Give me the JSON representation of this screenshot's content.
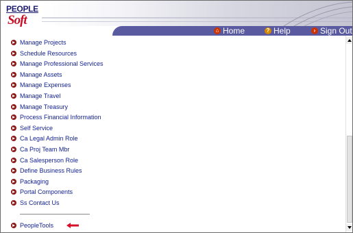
{
  "logo": {
    "line1": "PEOPLE",
    "line2": "Soft"
  },
  "nav": {
    "home": "Home",
    "help": "Help",
    "signout": "Sign Out"
  },
  "menu": [
    "Manage Projects",
    "Schedule Resources",
    "Manage Professional Services",
    "Manage Assets",
    "Manage Expenses",
    "Manage Travel",
    "Manage Treasury",
    "Process Financial Information",
    "Self Service",
    "Ca Legal Admin Role",
    "Ca Proj Team Mbr",
    "Ca Salesperson Role",
    "Define Business Rules",
    "Packaging",
    "Portal Components",
    "Ss Contact Us"
  ],
  "tools": "PeopleTools",
  "colors": {
    "link": "#0f1e8e",
    "navbar": "#5a5aa0",
    "arrow": "#d8102a"
  }
}
